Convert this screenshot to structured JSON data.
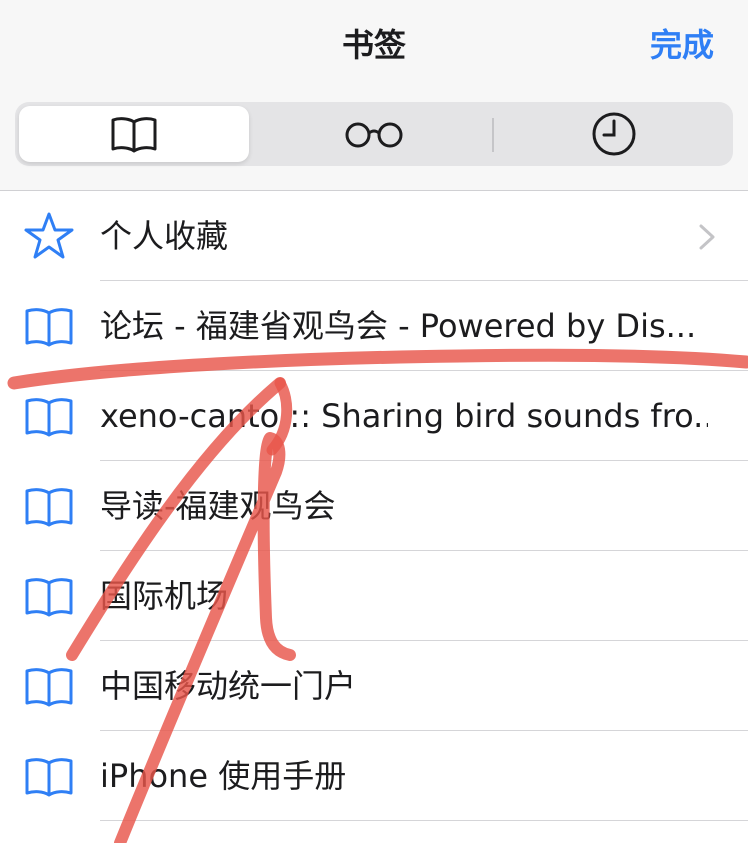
{
  "header": {
    "title": "书签",
    "done_label": "完成"
  },
  "tabs": [
    {
      "icon": "book-icon",
      "selected": true
    },
    {
      "icon": "reading-list-glasses-icon",
      "selected": false
    },
    {
      "icon": "history-clock-icon",
      "selected": false
    }
  ],
  "bookmarks": [
    {
      "label": "个人收藏",
      "icon": "star-icon",
      "has_chevron": true
    },
    {
      "label": "论坛 - 福建省观鸟会 - Powered by Dis...",
      "icon": "book-icon"
    },
    {
      "label": "xeno-canto :: Sharing bird sounds fro...",
      "icon": "book-icon"
    },
    {
      "label": "导读-福建观鸟会",
      "icon": "book-icon"
    },
    {
      "label": "国际机场",
      "icon": "book-icon"
    },
    {
      "label": "中国移动统一门户",
      "icon": "book-icon"
    },
    {
      "label": "iPhone 使用手册",
      "icon": "book-icon"
    }
  ],
  "colors": {
    "accent": "#2f7ff5",
    "annotation": "#e8564a"
  }
}
